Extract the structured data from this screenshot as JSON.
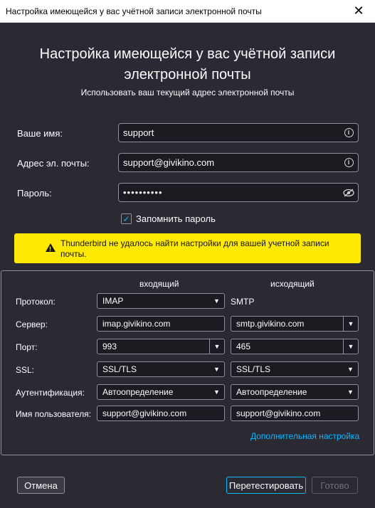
{
  "window": {
    "title": "Настройка имеющейся у вас учётной записи электронной почты",
    "close": "✕"
  },
  "header": {
    "title_line1": "Настройка имеющейся у вас учётной записи",
    "title_line2": "электронной почты",
    "subtitle": "Использовать ваш текущий адрес электронной почты"
  },
  "form": {
    "name_label": "Ваше имя:",
    "name_value": "support",
    "email_label": "Адрес эл. почты:",
    "email_value": "support@givikino.com",
    "password_label": "Пароль:",
    "password_value": "••••••••••",
    "remember_label": "Запомнить пароль",
    "remember_checked": "✓"
  },
  "warning": {
    "text": "Thunderbird не удалось найти настройки для вашей учетной записи почты."
  },
  "manual": {
    "incoming_header": "входящий",
    "outgoing_header": "исходящий",
    "protocol_label": "Протокол:",
    "protocol_in": "IMAP",
    "protocol_out": "SMTP",
    "server_label": "Сервер:",
    "server_in": "imap.givikino.com",
    "server_out": "smtp.givikino.com",
    "port_label": "Порт:",
    "port_in": "993",
    "port_out": "465",
    "ssl_label": "SSL:",
    "ssl_in": "SSL/TLS",
    "ssl_out": "SSL/TLS",
    "auth_label": "Аутентификация:",
    "auth_in": "Автоопределение",
    "auth_out": "Автоопределение",
    "user_label": "Имя пользователя:",
    "user_in": "support@givikino.com",
    "user_out": "support@givikino.com",
    "advanced_link": "Дополнительная настройка"
  },
  "buttons": {
    "cancel": "Отмена",
    "retest": "Перетестировать",
    "done": "Готово"
  },
  "colors": {
    "background": "#2b2a33",
    "warning": "#ffe900",
    "accent": "#0ab7ff"
  }
}
